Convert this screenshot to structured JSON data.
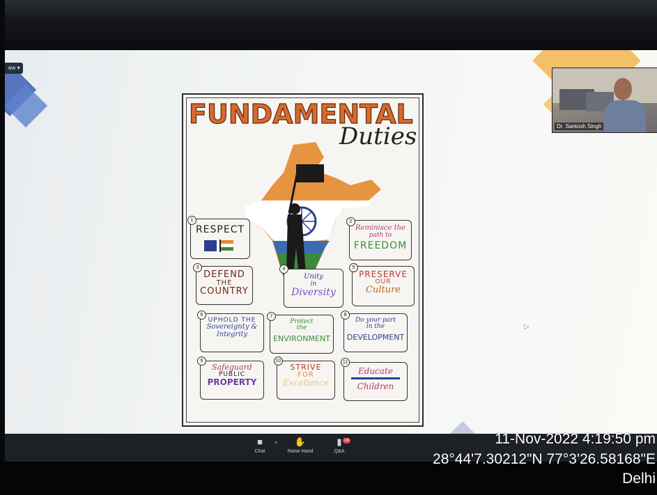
{
  "meeting": {
    "view_button_label": "ew ▾"
  },
  "poster": {
    "title_main": "FUNDAMENTAL",
    "title_sub": "Duties",
    "duties": [
      {
        "num": "1",
        "lines": [
          "RESPECT"
        ]
      },
      {
        "num": "2",
        "lines": [
          "Reminisce the",
          "path to",
          "FREEDOM"
        ]
      },
      {
        "num": "3",
        "lines": [
          "DEFEND",
          "THE",
          "COUNTRY"
        ]
      },
      {
        "num": "4",
        "lines": [
          "Unity",
          "in",
          "Diversity"
        ]
      },
      {
        "num": "5",
        "lines": [
          "PRESERVE",
          "OUR",
          "Culture"
        ]
      },
      {
        "num": "6",
        "lines": [
          "UPHOLD THE",
          "Sovereignty &",
          "Integrity"
        ]
      },
      {
        "num": "7",
        "lines": [
          "Protect",
          "the",
          "ENVIRONMENT"
        ]
      },
      {
        "num": "8",
        "lines": [
          "Do your part",
          "in the",
          "DEVELOPMENT"
        ]
      },
      {
        "num": "9",
        "lines": [
          "Safeguard",
          "PUBLIC",
          "PROPERTY"
        ]
      },
      {
        "num": "10",
        "lines": [
          "STRIVE",
          "FOR",
          "Excellence"
        ]
      },
      {
        "num": "11",
        "lines": [
          "Educate",
          "Children"
        ]
      }
    ]
  },
  "participant": {
    "name": "Dr. Santosh Singh"
  },
  "toolbar": {
    "chat_label": "Chat",
    "raise_hand_label": "Raise Hand",
    "qa_label": "Q&A",
    "qa_badge": "14"
  },
  "camera_stamp": {
    "datetime": "11-Nov-2022 4:19:50 pm",
    "coordinates": "28°44'7.30212\"N 77°3'26.58168\"E",
    "city": "Delhi"
  },
  "colors": {
    "saffron": "#e48a2e",
    "green": "#3e8a3a",
    "chakra_blue": "#2a3f8f",
    "toolbar": "#1d2024"
  }
}
